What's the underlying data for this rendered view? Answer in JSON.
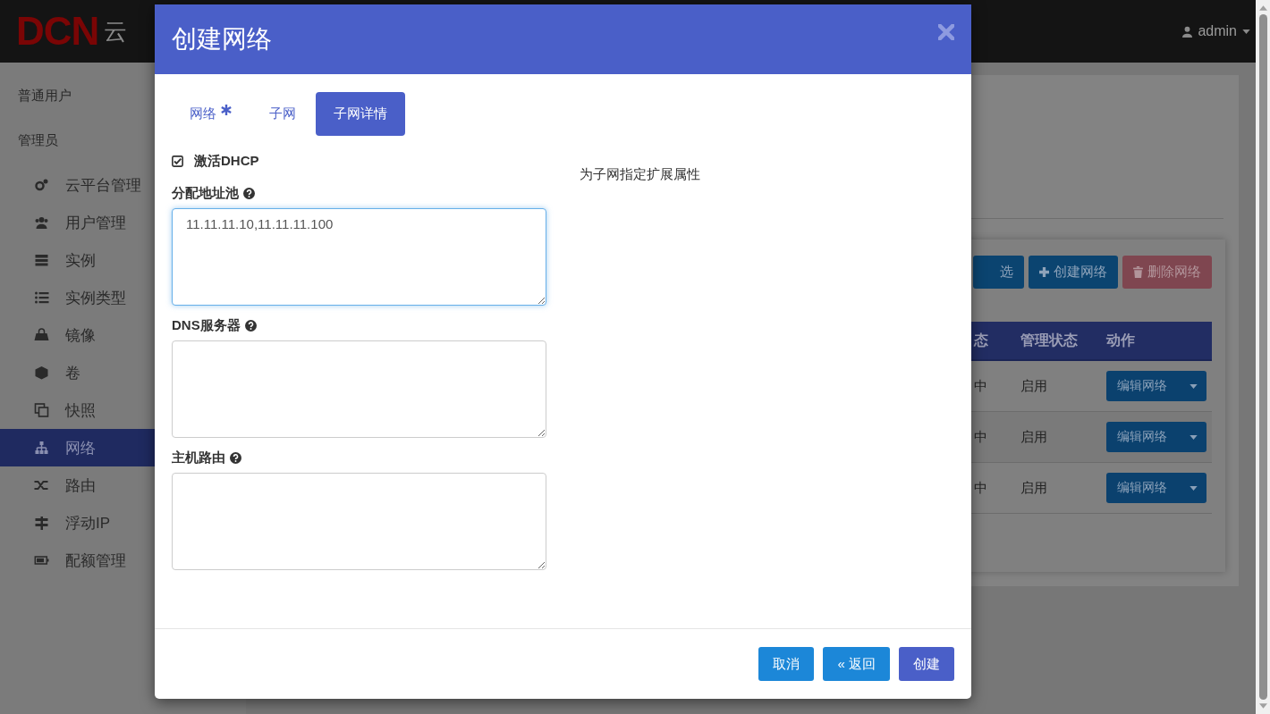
{
  "header": {
    "logo": "DCN",
    "logo_text": "云",
    "user": "admin"
  },
  "sidebar": {
    "headings": [
      "普通用户",
      "管理员"
    ],
    "items": [
      {
        "label": "云平台管理",
        "selected": false
      },
      {
        "label": "用户管理",
        "selected": false
      },
      {
        "label": "实例",
        "selected": false
      },
      {
        "label": "实例类型",
        "selected": false
      },
      {
        "label": "镜像",
        "selected": false
      },
      {
        "label": "卷",
        "selected": false
      },
      {
        "label": "快照",
        "selected": false
      },
      {
        "label": "网络",
        "selected": true
      },
      {
        "label": "路由",
        "selected": false
      },
      {
        "label": "浮动IP",
        "selected": false
      },
      {
        "label": "配额管理",
        "selected": false
      }
    ]
  },
  "content": {
    "toolbar": [
      {
        "label": "选",
        "kind": "filter"
      },
      {
        "label": "创建网络",
        "kind": "create"
      },
      {
        "label": "删除网络",
        "kind": "delete"
      }
    ],
    "table": {
      "columns": [
        "态",
        "管理状态",
        "动作"
      ],
      "rows": [
        {
          "cells": [
            "中",
            "启用"
          ],
          "action": "编辑网络"
        },
        {
          "cells": [
            "中",
            "启用"
          ],
          "action": "编辑网络"
        },
        {
          "cells": [
            "中",
            "启用"
          ],
          "action": "编辑网络"
        }
      ]
    }
  },
  "modal": {
    "title": "创建网络",
    "tabs": [
      {
        "label": "网络",
        "required": true,
        "selected": false
      },
      {
        "label": "子网",
        "required": false,
        "selected": false
      },
      {
        "label": "子网详情",
        "required": false,
        "selected": true
      }
    ],
    "dhcp": {
      "label": "激活DHCP",
      "checked": true
    },
    "fields": [
      {
        "label": "分配地址池",
        "value": "11.11.11.10,11.11.11.100",
        "focused": true
      },
      {
        "label": "DNS服务器",
        "focused": false
      },
      {
        "label": "主机路由",
        "focused": false
      }
    ],
    "description": "为子网指定扩展属性",
    "buttons": [
      {
        "label": "取消",
        "kind": "cancel"
      },
      {
        "label": "« 返回",
        "kind": "back"
      },
      {
        "label": "创建",
        "kind": "submit"
      }
    ]
  }
}
